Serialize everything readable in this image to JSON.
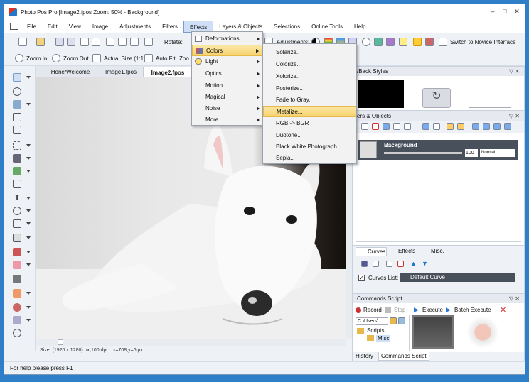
{
  "window": {
    "title": "Photo Pos Pro [Image2.fpos Zoom: 50% - Background]",
    "controls": [
      "–",
      "□",
      "✕"
    ]
  },
  "menubar": [
    "File",
    "Edit",
    "View",
    "Image",
    "Adjustments",
    "Filters",
    "Effects",
    "Layers & Objects",
    "Selections",
    "Online Tools",
    "Help"
  ],
  "toolbar1": {
    "rotate_label": "Rotate:",
    "adjustments_label": "Adjustments:",
    "novice_label": "Switch to Novice Interface"
  },
  "toolbar2": {
    "zoom_in": "Zoom In",
    "zoom_out": "Zoom Out",
    "actual_size": "Actual Size (1:1)",
    "auto_fit": "Auto Fit",
    "zoom": "Zoo"
  },
  "doc_tabs": [
    "Hone/Welcome",
    "Image1.fpos",
    "Image2.fpos"
  ],
  "active_tab": "Image2.fpos",
  "status": {
    "size": "Size: (1920 x 1280) px,100 dpi",
    "coords": "x=708,y=6 px",
    "help": "For help please press F1"
  },
  "effects_menu": [
    {
      "label": "Deformations",
      "submenu": true
    },
    {
      "label": "Colors",
      "submenu": true,
      "highlighted": true
    },
    {
      "label": "Light",
      "submenu": true
    },
    {
      "label": "Optics",
      "submenu": true
    },
    {
      "label": "Motion",
      "submenu": true
    },
    {
      "label": "Magical",
      "submenu": true
    },
    {
      "label": "Noise",
      "submenu": true
    },
    {
      "label": "More",
      "submenu": true
    }
  ],
  "colors_submenu": [
    {
      "label": "Solarize.."
    },
    {
      "label": "Colorize.."
    },
    {
      "label": "Xolorize.."
    },
    {
      "label": "Posterize.."
    },
    {
      "label": "Fade to Gray.."
    },
    {
      "label": "Metalize...",
      "highlighted": true
    },
    {
      "label": "RGB -> BGR"
    },
    {
      "label": "Duotone.."
    },
    {
      "label": "Black  White Photograph.."
    },
    {
      "label": "Sepia.."
    }
  ],
  "styles_panel": {
    "title": "/Back Styles"
  },
  "layers_panel": {
    "title": "ers & Objects",
    "layer_name": "Background",
    "opacity": "100",
    "blend": "Normal"
  },
  "curves_panel": {
    "tabs": [
      "Curves",
      "Effects",
      "Misc."
    ],
    "curves_list_label": "Curves List:",
    "curve": "Default Curve"
  },
  "commands_panel": {
    "title": "Commands Script",
    "record": "Record",
    "stop": "Stop",
    "execute": "Execute",
    "batch": "Batch Execute",
    "path": "C:\\Users\\",
    "folders": [
      "Scripts",
      "Misc"
    ],
    "tabs": [
      "History",
      "Commands Script"
    ]
  },
  "colors": {
    "accent": "#cfe0f6",
    "highlight": "#f6d36f",
    "desktop": "#2f7fc8"
  }
}
